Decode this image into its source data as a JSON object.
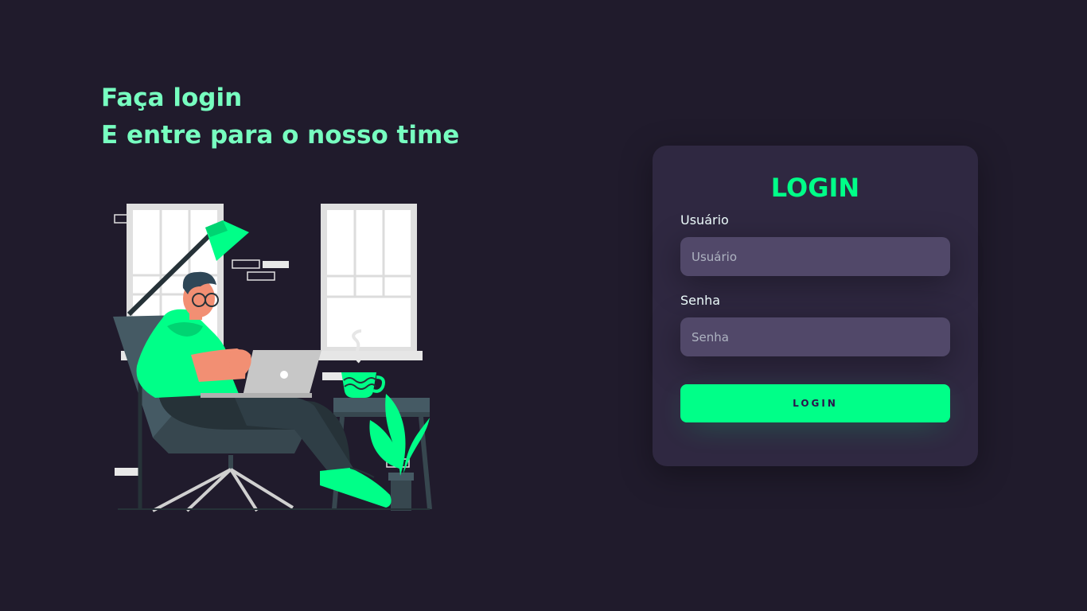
{
  "hero": {
    "line1": "Faça login",
    "line2": "E entre para o nosso time"
  },
  "login_card": {
    "title": "LOGIN",
    "username_label": "Usuário",
    "username_placeholder": "Usuário",
    "password_label": "Senha",
    "password_placeholder": "Senha",
    "submit_label": "LOGIN"
  },
  "colors": {
    "background": "#201b2c",
    "card": "#2f2841",
    "input": "#514869",
    "accent": "#00ff88",
    "headline": "#77ffc0"
  }
}
